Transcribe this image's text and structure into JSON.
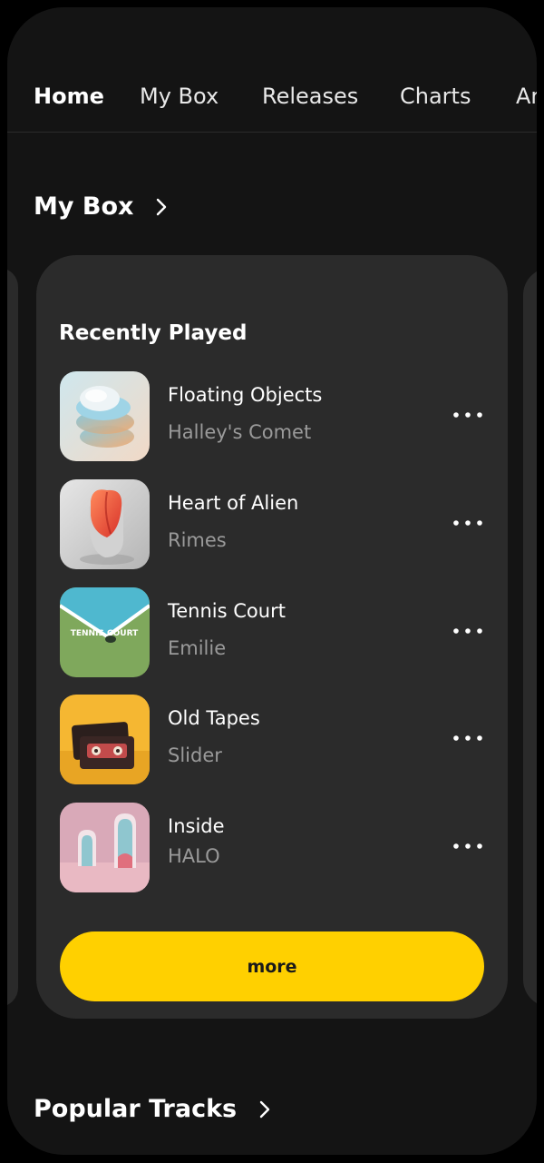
{
  "nav": {
    "tabs": [
      {
        "label": "Home",
        "active": true
      },
      {
        "label": "My Box",
        "active": false
      },
      {
        "label": "Releases",
        "active": false
      },
      {
        "label": "Charts",
        "active": false
      },
      {
        "label": "Ar",
        "active": false
      }
    ]
  },
  "my_box": {
    "title": "My Box",
    "icon": "chevron-right-icon"
  },
  "recent": {
    "title": "Recently Played",
    "tracks": [
      {
        "title": "Floating Objects",
        "artist": "Halley's Comet",
        "cover": "floating-objects-cover"
      },
      {
        "title": "Heart of Alien",
        "artist": "Rimes",
        "cover": "heart-of-alien-cover"
      },
      {
        "title": "Tennis Court",
        "artist": "Emilie",
        "cover": "tennis-court-cover",
        "cover_text": "TENNIS COURT"
      },
      {
        "title": "Old Tapes",
        "artist": "Slider",
        "cover": "old-tapes-cover"
      },
      {
        "title": "Inside",
        "artist": "HALO",
        "cover": "inside-cover"
      }
    ],
    "more_label": "more"
  },
  "popular": {
    "title": "Popular Tracks",
    "icon": "chevron-right-icon"
  },
  "colors": {
    "background": "#141414",
    "card": "#2b2b2b",
    "accent": "#ffd000",
    "text_primary": "#ffffff",
    "text_secondary": "#9a9a9a"
  }
}
